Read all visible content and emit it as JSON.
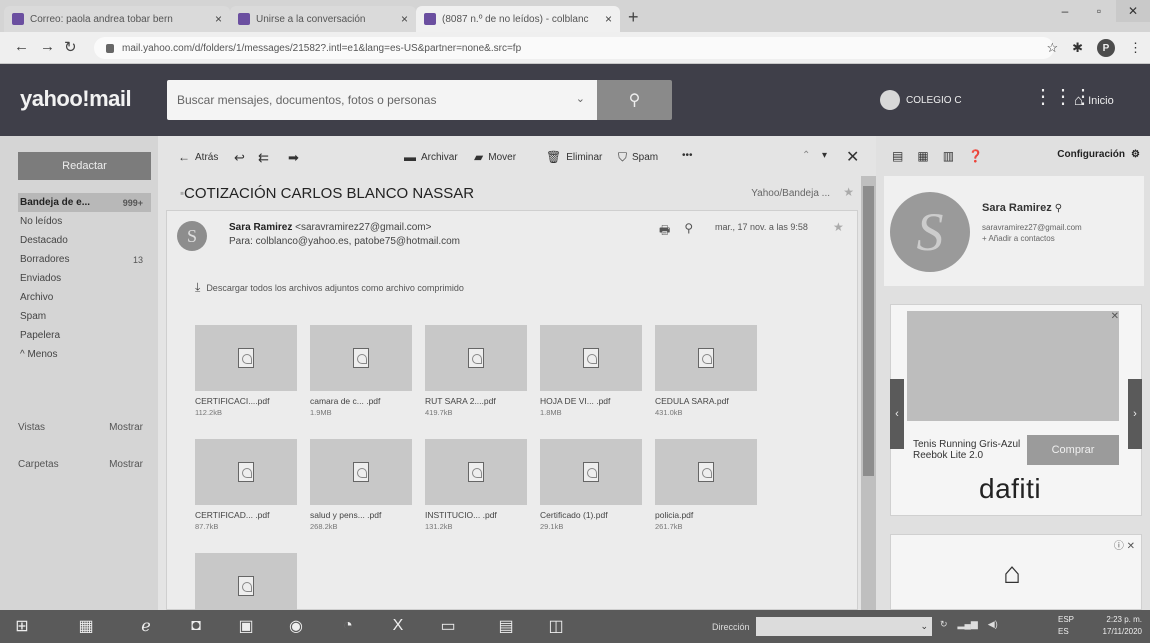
{
  "browser": {
    "tabs": [
      {
        "label": "Correo: paola andrea tobar bern",
        "active": false
      },
      {
        "label": "Unirse a la conversación",
        "active": false
      },
      {
        "label": "(8087 n.º de no leídos) - colblanc",
        "active": true
      }
    ],
    "url": "mail.yahoo.com/d/folders/1/messages/21582?.intl=e1&lang=es-US&partner=none&.src=fp",
    "profile_initial": "P"
  },
  "header": {
    "logo": "yahoo!mail",
    "search_placeholder": "Buscar mensajes, documentos, fotos o personas",
    "user_name": "COLEGIO C",
    "home_label": "Inicio"
  },
  "sidebar": {
    "compose_label": "Redactar",
    "folders": [
      {
        "label": "Bandeja de e...",
        "count": "999+",
        "selected": true
      },
      {
        "label": "No leídos",
        "count": "",
        "selected": false
      },
      {
        "label": "Destacado",
        "count": "",
        "selected": false
      },
      {
        "label": "Borradores",
        "count": "13",
        "selected": false
      },
      {
        "label": "Enviados",
        "count": "",
        "selected": false
      },
      {
        "label": "Archivo",
        "count": "",
        "selected": false
      },
      {
        "label": "Spam",
        "count": "",
        "selected": false
      },
      {
        "label": "Papelera",
        "count": "",
        "selected": false
      },
      {
        "label": "^ Menos",
        "count": "",
        "selected": false
      }
    ],
    "views_label": "Vistas",
    "views_action": "Mostrar",
    "folders_label": "Carpetas",
    "folders_action": "Mostrar"
  },
  "toolbar": {
    "back": "Atrás",
    "archive": "Archivar",
    "move": "Mover",
    "delete": "Eliminar",
    "spam": "Spam",
    "more": "•••"
  },
  "message": {
    "subject": "COTIZACIÓN CARLOS BLANCO NASSAR",
    "folder_tag": "Yahoo/Bandeja ...",
    "sender_initial": "S",
    "sender_name": "Sara Ramirez",
    "sender_email": "<saravramirez27@gmail.com>",
    "recipients": "Para: colblanco@yahoo.es,  patobe75@hotmail.com",
    "date": "mar., 17 nov. a las 9:58",
    "download_all": "Descargar todos los archivos adjuntos como archivo comprimido",
    "attachments": [
      {
        "name": "CERTIFICACI....pdf",
        "size": "112.2kB"
      },
      {
        "name": "camara de c... .pdf",
        "size": "1.9MB"
      },
      {
        "name": "RUT SARA 2....pdf",
        "size": "419.7kB"
      },
      {
        "name": "HOJA DE VI... .pdf",
        "size": "1.8MB"
      },
      {
        "name": "CEDULA SARA.pdf",
        "size": "431.0kB"
      },
      {
        "name": "CERTIFICAD... .pdf",
        "size": "87.7kB"
      },
      {
        "name": "salud y pens... .pdf",
        "size": "268.2kB"
      },
      {
        "name": "INSTITUCIO... .pdf",
        "size": "131.2kB"
      },
      {
        "name": "Certificado (1).pdf",
        "size": "29.1kB"
      },
      {
        "name": "policia.pdf",
        "size": "261.7kB"
      },
      {
        "name": "",
        "size": ""
      }
    ]
  },
  "right_panel": {
    "settings_label": "Configuración",
    "contact_initial": "S",
    "contact_name": "Sara Ramirez",
    "contact_email": "saravramirez27@gmail.com",
    "add_contact": "+ Añadir a contactos",
    "ad_product": "Tenis Running Gris-Azul Reebok Lite 2.0",
    "ad_button": "Comprar",
    "ad_brand": "dafiti"
  },
  "taskbar": {
    "address_label": "Dirección",
    "lang_top": "ESP",
    "lang_bottom": "ES",
    "time": "2:23 p. m.",
    "date": "17/11/2020"
  }
}
